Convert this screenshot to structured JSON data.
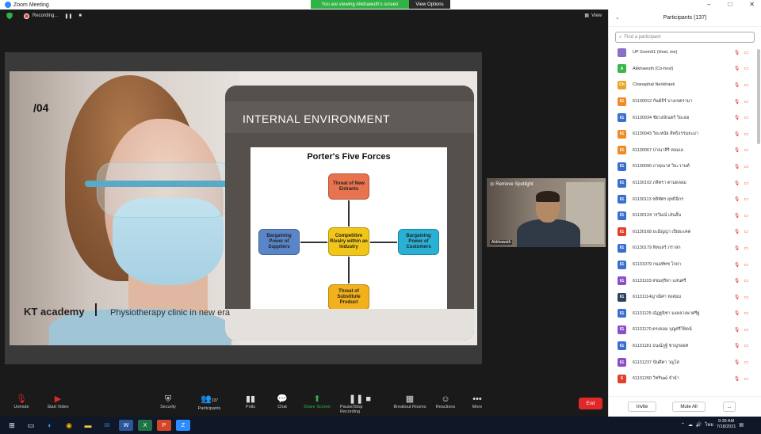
{
  "window": {
    "title": "Zoom Meeting"
  },
  "banner": {
    "message": "You are viewing Akkhawuth's screen",
    "view_options": "View Options"
  },
  "window_controls": {
    "minimize": "–",
    "maximize": "□",
    "close": "✕"
  },
  "meeting_top": {
    "recording": "Recording...",
    "pause": "❚❚",
    "stop": "■",
    "view": "View"
  },
  "slide": {
    "number": "/04",
    "header": "INTERNAL  ENVIRONMENT",
    "footer_left": "KT academy",
    "footer_right": "Physiotherapy clinic in new era"
  },
  "diagram": {
    "title": "Porter's Five Forces",
    "new_entrants": "Threat of New Entrants",
    "suppliers": "Bargaining Power of Suppliers",
    "rivalry": "Competitive Rivalry within an Industry",
    "customers": "Bargaining Power of Customers",
    "substitutes": "Threat of Substitute Product"
  },
  "presenter": {
    "spotlight": "Remove Spotlight",
    "name": "Akkhawuth"
  },
  "toolbar": {
    "unmute": "Unmute",
    "start_video": "Start Video",
    "security": "Security",
    "participants": "Participants",
    "participants_count": "137",
    "polls": "Polls",
    "chat": "Chat",
    "share_screen": "Share Screen",
    "recording": "Pause/Stop Recording",
    "breakout": "Breakout Rooms",
    "reactions": "Reactions",
    "more": "More",
    "end": "End"
  },
  "participants_panel": {
    "title": "Participants (137)",
    "search_placeholder": "Find a participant",
    "invite": "Invite",
    "mute_all": "Mute All",
    "more": "...",
    "items": [
      {
        "initials": "",
        "name": "UP Zoom01 (Host, me)",
        "color": "#8a6fc7"
      },
      {
        "initials": "A",
        "name": "Akkhawuth (Co-host)",
        "color": "#3cb54a"
      },
      {
        "initials": "Ch",
        "name": "Chanaphat Nenkhaek",
        "color": "#e8a52a"
      },
      {
        "initials": "61",
        "name": "61130012 กันต์ธีร์ บางเขตรามา",
        "color": "#f08a24"
      },
      {
        "initials": "61",
        "name": "61130034 ชัยวงษ์เนตร์ วิยะยอ",
        "color": "#3a6fd0"
      },
      {
        "initials": "61",
        "name": "61130043 วิยะหนัย สิทธิธรรมยะมา",
        "color": "#f08a24"
      },
      {
        "initials": "61",
        "name": "61130067 ปาณาสิริ หอมเอ",
        "color": "#f08a24"
      },
      {
        "initials": "61",
        "name": "61130090 ภาคุณาส วิยะวานต์",
        "color": "#3a6fd0"
      },
      {
        "initials": "61",
        "name": "61130102 ภสิตรา ตามดลอม",
        "color": "#3a6fd0"
      },
      {
        "initials": "61",
        "name": "61130113 ชลิทัศร ยุทธินีกร",
        "color": "#3a6fd0"
      },
      {
        "initials": "61",
        "name": "61130124 วรวิมณ์ เส่นอั้น",
        "color": "#3a6fd0"
      },
      {
        "initials": "61",
        "name": "61130168 ยะมิญญา เปียยะเคต",
        "color": "#e0412b"
      },
      {
        "initials": "61",
        "name": "61130179 พิทแสร์ ภราสก",
        "color": "#3a6fd0"
      },
      {
        "initials": "61",
        "name": "61131079 กนอทัทช โกยา",
        "color": "#3a6fd0"
      },
      {
        "initials": "61",
        "name": "61131103 สขมสุริตา แสนศรี",
        "color": "#8a4fc7"
      },
      {
        "initials": "61",
        "name": "61131114ญาณิศา หงสมม",
        "color": "#2f3f5f"
      },
      {
        "initials": "61",
        "name": "61131125 ณัฏฐนิชา มงคลวงษาศรีฐ",
        "color": "#3a6fd0"
      },
      {
        "initials": "61",
        "name": "61131170 ตรงจอม บุญศรีโพิคน์",
        "color": "#8a4fc7"
      },
      {
        "initials": "61",
        "name": "61131181 ธนณ์ภูฐ์ ชาญรอยศ",
        "color": "#3a6fd0"
      },
      {
        "initials": "61",
        "name": "61131237 นันศิตา วญโส",
        "color": "#8a4fc7"
      },
      {
        "initials": "6",
        "name": "61131260 วิชรินฒ์ จำนำ",
        "color": "#e0412b"
      }
    ]
  },
  "taskbar": {
    "time": "9:39 AM",
    "date": "7/18/2021",
    "lang": "ไทย"
  }
}
